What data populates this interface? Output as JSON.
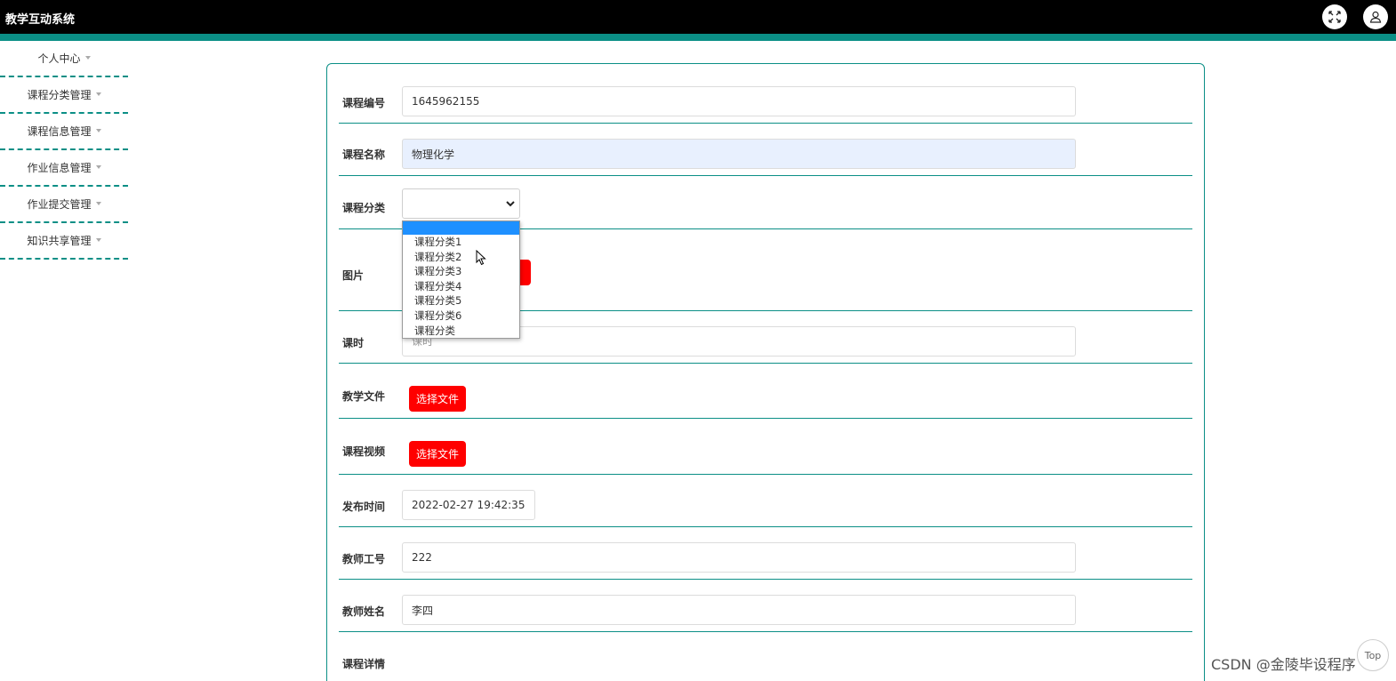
{
  "app": {
    "title": "教学互动系统"
  },
  "header": {
    "fullscreen_icon": "expand-icon",
    "user_icon": "user-icon"
  },
  "sidebar": {
    "items": [
      {
        "label": "个人中心"
      },
      {
        "label": "课程分类管理"
      },
      {
        "label": "课程信息管理"
      },
      {
        "label": "作业信息管理"
      },
      {
        "label": "作业提交管理"
      },
      {
        "label": "知识共享管理"
      }
    ]
  },
  "form": {
    "course_no": {
      "label": "课程编号",
      "value": "1645962155"
    },
    "course_name": {
      "label": "课程名称",
      "value": "物理化学"
    },
    "course_category": {
      "label": "课程分类",
      "value": "",
      "options": [
        "",
        "课程分类1",
        "课程分类2",
        "课程分类3",
        "课程分类4",
        "课程分类5",
        "课程分类6",
        "课程分类"
      ]
    },
    "image": {
      "label": "图片"
    },
    "hours": {
      "label": "课时",
      "placeholder": "课时"
    },
    "teaching_file": {
      "label": "教学文件",
      "button": "选择文件"
    },
    "course_video": {
      "label": "课程视频",
      "button": "选择文件"
    },
    "publish_time": {
      "label": "发布时间",
      "value": "2022-02-27 19:42:35"
    },
    "teacher_id": {
      "label": "教师工号",
      "value": "222"
    },
    "teacher_name": {
      "label": "教师姓名",
      "value": "李四"
    },
    "course_detail": {
      "label": "课程详情"
    }
  },
  "watermark": "CSDN @金陵毕设程序",
  "top_button": "Top",
  "colors": {
    "accent": "#0b8f86",
    "button": "#ff0000",
    "selected_option": "#1e90ff"
  }
}
